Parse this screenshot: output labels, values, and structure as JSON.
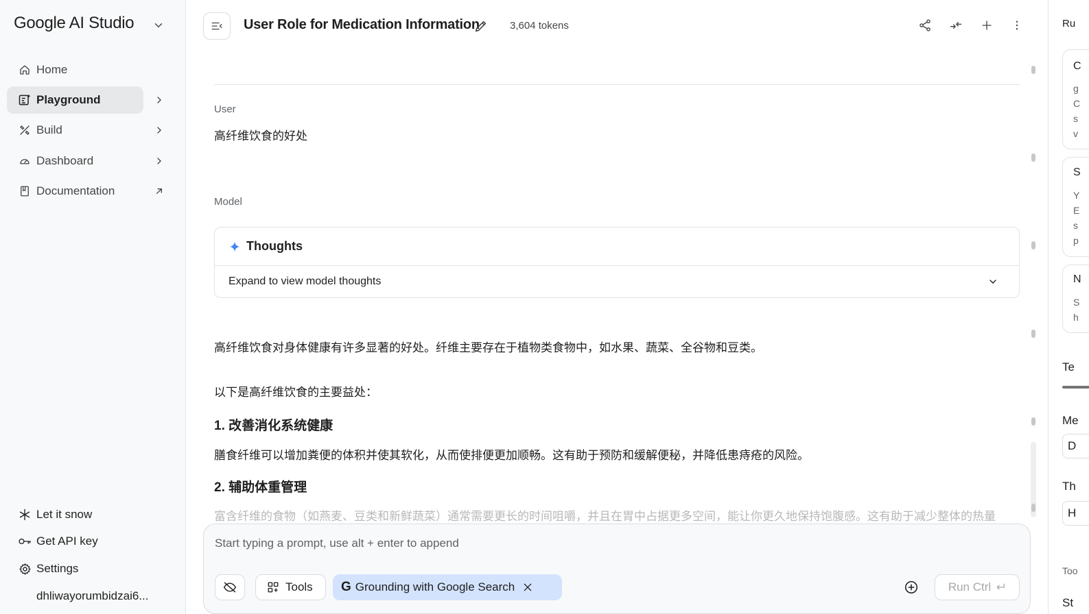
{
  "sidebar": {
    "brand": "Google AI Studio",
    "nav": [
      {
        "label": "Home",
        "icon": "home-icon"
      },
      {
        "label": "Playground",
        "icon": "playground-icon",
        "active": true
      },
      {
        "label": "Build",
        "icon": "build-icon"
      },
      {
        "label": "Dashboard",
        "icon": "dashboard-icon"
      },
      {
        "label": "Documentation",
        "icon": "book-icon",
        "external": true
      }
    ],
    "bottom": [
      {
        "label": "Let it snow",
        "icon": "snowflake-icon"
      },
      {
        "label": "Get API key",
        "icon": "key-icon"
      },
      {
        "label": "Settings",
        "icon": "gear-icon"
      }
    ],
    "account": "dhliwayorumbidzai6..."
  },
  "header": {
    "title": "User Role for Medication Information",
    "tokens": "3,604 tokens"
  },
  "chat": {
    "user_label": "User",
    "user_message": "高纤维饮食的好处",
    "model_label": "Model",
    "thoughts_title": "Thoughts",
    "thoughts_expand": "Expand to view model thoughts",
    "p1": "高纤维饮食对身体健康有许多显著的好处。纤维主要存在于植物类食物中，如水果、蔬菜、全谷物和豆类。",
    "p2": "以下是高纤维饮食的主要益处：",
    "h1": "1. 改善消化系统健康",
    "p3": "膳食纤维可以增加粪便的体积并使其软化，从而使排便更加顺畅。这有助于预防和缓解便秘，并降低患痔疮的风险。",
    "h2": "2. 辅助体重管理",
    "p4": "富含纤维的食物（如燕麦、豆类和新鲜蔬菜）通常需要更长的时间咀嚼，并且在胃中占据更多空间，能让你更久地保持饱腹感。这有助于减少整体的热量"
  },
  "composer": {
    "placeholder": "Start typing a prompt, use alt + enter to append",
    "tools_label": "Tools",
    "grounding_label": "Grounding with Google Search",
    "run_label": "Run Ctrl"
  },
  "right_panel": {
    "run_label": "Ru",
    "card1_title": "C",
    "card1_lines": [
      "g",
      "C",
      "s",
      "v"
    ],
    "card2_title": "S",
    "card2_lines": [
      "Y",
      "E",
      "s",
      "p"
    ],
    "card3_title": "N",
    "card3_lines": [
      "S",
      "h"
    ],
    "temp_label": "Te",
    "media_label": "Me",
    "media_value": "D",
    "think_label": "Th",
    "think_value": "H",
    "tools_label": "Too",
    "st_label": "St"
  },
  "colors": {
    "accent_blue": "#1a73e8",
    "grounding_chip": "#d3e3fd",
    "sidebar_bg": "#f8f9fa"
  }
}
